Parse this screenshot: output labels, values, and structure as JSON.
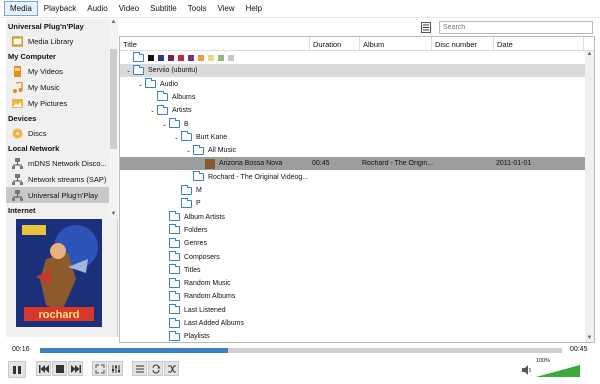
{
  "menu": [
    "Media",
    "Playback",
    "Audio",
    "Video",
    "Subtitle",
    "Tools",
    "View",
    "Help"
  ],
  "sidebar": {
    "sections": [
      {
        "title": "Universal Plug'n'Play",
        "items": [
          {
            "label": "Media Library",
            "icon": "media-library-icon"
          }
        ]
      },
      {
        "title": "My Computer",
        "items": [
          {
            "label": "My Videos",
            "icon": "film-icon"
          },
          {
            "label": "My Music",
            "icon": "music-note-icon"
          },
          {
            "label": "My Pictures",
            "icon": "picture-icon"
          }
        ]
      },
      {
        "title": "Devices",
        "items": [
          {
            "label": "Discs",
            "icon": "disc-icon"
          }
        ]
      },
      {
        "title": "Local Network",
        "items": [
          {
            "label": "mDNS Network Disco...",
            "icon": "network-icon"
          },
          {
            "label": "Network streams (SAP)",
            "icon": "network-icon"
          },
          {
            "label": "Universal Plug'n'Play",
            "icon": "network-icon"
          }
        ]
      },
      {
        "title": "Internet",
        "items": []
      }
    ]
  },
  "search": {
    "placeholder": "Search"
  },
  "columns": [
    "Title",
    "Duration",
    "Album",
    "Disc number",
    "Date"
  ],
  "tree": [
    {
      "label": "",
      "type": "color-row"
    },
    {
      "label": "Serviio (ubuntu)",
      "type": "folder",
      "toggle": "v"
    },
    {
      "label": "Audio",
      "type": "folder",
      "toggle": "v"
    },
    {
      "label": "Albums",
      "type": "folder",
      "toggle": ""
    },
    {
      "label": "Artists",
      "type": "folder",
      "toggle": "v"
    },
    {
      "label": "B",
      "type": "folder",
      "toggle": "v"
    },
    {
      "label": "Burt Kane",
      "type": "folder",
      "toggle": "v"
    },
    {
      "label": "All Music",
      "type": "folder",
      "toggle": "v"
    },
    {
      "label": "Arizona Bossa Nova",
      "type": "track",
      "toggle": "",
      "duration": "00:45",
      "album": "Rochard - The Origin...",
      "date": "2011-01-01"
    },
    {
      "label": "Rochard - The Original Videog...",
      "type": "folder",
      "toggle": ""
    },
    {
      "label": "M",
      "type": "folder",
      "toggle": ""
    },
    {
      "label": "P",
      "type": "folder",
      "toggle": ""
    },
    {
      "label": "Album Artists",
      "type": "folder",
      "toggle": ""
    },
    {
      "label": "Folders",
      "type": "folder",
      "toggle": ""
    },
    {
      "label": "Genres",
      "type": "folder",
      "toggle": ""
    },
    {
      "label": "Composers",
      "type": "folder",
      "toggle": ""
    },
    {
      "label": "Titles",
      "type": "folder",
      "toggle": ""
    },
    {
      "label": "Random Music",
      "type": "folder",
      "toggle": ""
    },
    {
      "label": "Random Albums",
      "type": "folder",
      "toggle": ""
    },
    {
      "label": "Last Listened",
      "type": "folder",
      "toggle": ""
    },
    {
      "label": "Last Added Albums",
      "type": "folder",
      "toggle": ""
    },
    {
      "label": "Playlists",
      "type": "folder",
      "toggle": ""
    }
  ],
  "player": {
    "elapsed": "00:16",
    "total": "00:45",
    "progress": 0.36,
    "volume_label": "100%",
    "volume": 1.0
  },
  "colors": {
    "accent": "#3b7fc4",
    "selected": "#9d9d9d",
    "row_grey": "#dadada"
  }
}
